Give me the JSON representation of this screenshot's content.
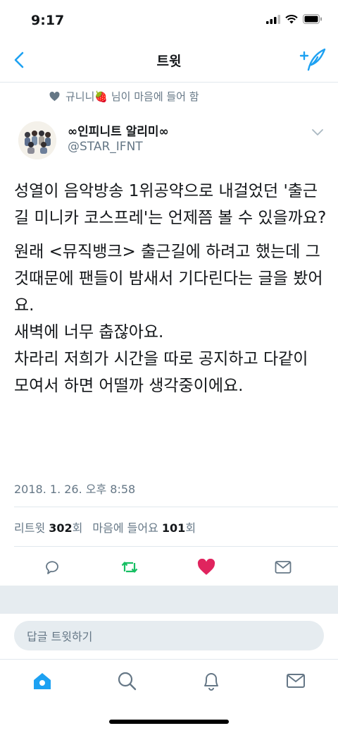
{
  "status_bar": {
    "time": "9:17"
  },
  "nav": {
    "title": "트윗"
  },
  "social_context": {
    "text": "규니니🍓 님이 마음에 들어 함"
  },
  "author": {
    "name": "∞인피니트 알리미∞",
    "handle": "@STAR_IFNT"
  },
  "tweet": {
    "paragraphs": [
      "성열이 음악방송 1위공약으로 내걸었던 '출근길 미니카 코스프레'는 언제쯤 볼 수 있을까요?",
      "원래 <뮤직뱅크> 출근길에 하려고 했는데 그것때문에 팬들이 밤새서 기다린다는 글을 봤어요.\n새벽에 너무 춥잖아요.\n차라리 저희가 시간을 따로 공지하고 다같이 모여서 하면 어떨까 생각중이에요."
    ],
    "timestamp": "2018. 1. 26. 오후 8:58"
  },
  "stats": {
    "retweet_label": "리트윗",
    "retweet_count": "302",
    "retweet_unit": "회",
    "like_label": "마음에 들어요",
    "like_count": "101",
    "like_unit": "회"
  },
  "actions": [
    "reply-icon",
    "retweet-icon",
    "like-icon",
    "dm-icon"
  ],
  "reply": {
    "placeholder": "답글 트윗하기"
  },
  "tabs": [
    "home-icon",
    "search-icon",
    "notifications-icon",
    "messages-icon"
  ],
  "colors": {
    "accent": "#1da1f2",
    "retweet": "#17bf63",
    "like": "#e0245e",
    "muted": "#657786",
    "divider": "#e1e8ed"
  }
}
